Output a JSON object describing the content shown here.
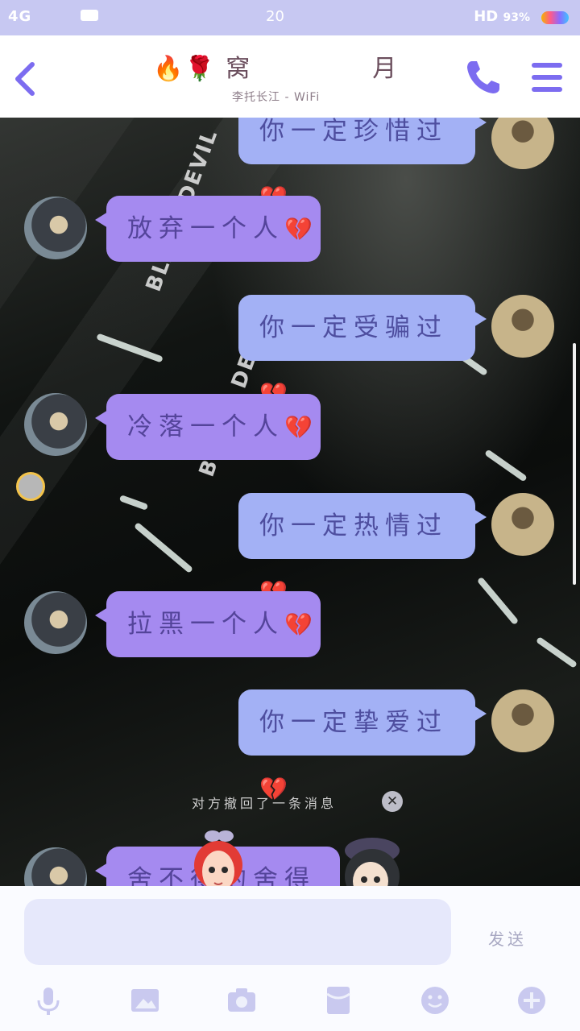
{
  "status_bar": {
    "network": "4G",
    "time": "20",
    "wifi": "HD",
    "battery": "93%"
  },
  "header": {
    "title_left": "🔥🌹 窝",
    "title_right": "月",
    "subtitle": "李托长江 - WiFi"
  },
  "background_text": [
    "BLACK DEVIL",
    "BLACK DEVIL"
  ],
  "messages": [
    {
      "side": "right",
      "text": "你一定珍惜过",
      "emoji": "💔"
    },
    {
      "side": "left",
      "text": "放弃一个人",
      "emoji": "💔"
    },
    {
      "side": "right",
      "text": "你一定受骗过",
      "emoji": "💔"
    },
    {
      "side": "left",
      "text": "冷落一个人",
      "emoji": "💔"
    },
    {
      "side": "right",
      "text": "你一定热情过",
      "emoji": "💔"
    },
    {
      "side": "left",
      "text": "拉黑一个人",
      "emoji": "💔"
    },
    {
      "side": "right",
      "text": "你一定挚爱过",
      "emoji": "💔"
    },
    {
      "side": "left",
      "text": "舍不得的舍得",
      "emoji": ""
    }
  ],
  "recall_notice": "对方撤回了一条消息",
  "input_bar": {
    "placeholder": "",
    "send_label": "发送"
  },
  "toolbar_icons": [
    "microphone-icon",
    "image-icon",
    "camera-icon",
    "red-packet-icon",
    "emoji-icon",
    "plus-icon"
  ],
  "colors": {
    "accent": "#7c6cf0",
    "bubble_right": "#a3b1f5",
    "bubble_left": "#a58af0",
    "status_bar": "#c7c8f2"
  }
}
